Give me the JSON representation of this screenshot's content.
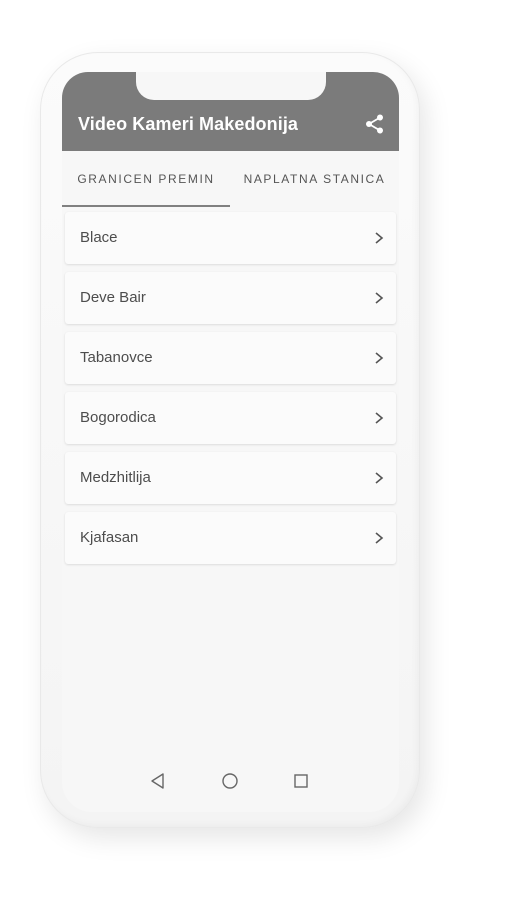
{
  "app": {
    "title": "Video Kameri Makedonija",
    "bar_color": "#7b7b7b"
  },
  "header": {
    "share_icon": "share-icon"
  },
  "tabs": [
    {
      "label": "GRANICEN PREMIN",
      "selected": true
    },
    {
      "label": "NAPLATNA STANICA",
      "selected": false
    }
  ],
  "list": {
    "items": [
      {
        "label": "Blace"
      },
      {
        "label": "Deve Bair"
      },
      {
        "label": "Tabanovce"
      },
      {
        "label": "Bogorodica"
      },
      {
        "label": "Medzhitlija"
      },
      {
        "label": "Kjafasan"
      }
    ],
    "item_icon": "chevron-right-icon"
  },
  "navbar": {
    "back_icon": "back-triangle-icon",
    "home_icon": "home-circle-icon",
    "recents_icon": "recents-square-icon"
  }
}
